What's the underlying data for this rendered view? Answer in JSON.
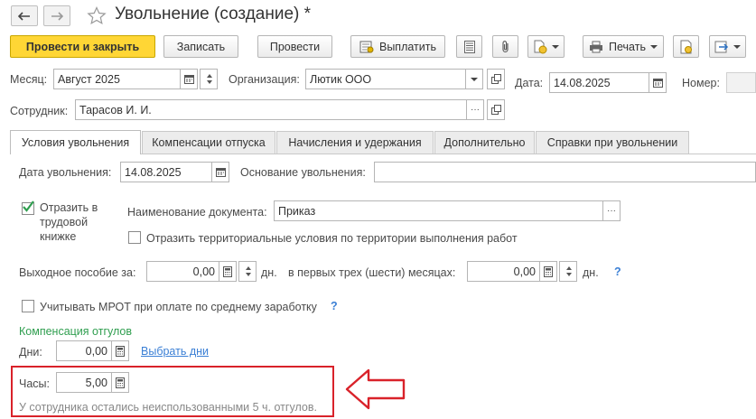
{
  "window": {
    "title": "Увольнение (создание) *"
  },
  "toolbar": {
    "post_and_close": "Провести и закрыть",
    "save": "Записать",
    "post": "Провести",
    "pay": "Выплатить",
    "print": "Печать"
  },
  "header": {
    "month_label": "Месяц:",
    "month_value": "Август 2025",
    "org_label": "Организация:",
    "org_value": "Лютик ООО",
    "date_label": "Дата:",
    "date_value": "14.08.2025",
    "number_label": "Номер:",
    "employee_label": "Сотрудник:",
    "employee_value": "Тарасов И. И."
  },
  "tabs": [
    {
      "label": "Условия увольнения"
    },
    {
      "label": "Компенсации отпуска"
    },
    {
      "label": "Начисления и удержания"
    },
    {
      "label": "Дополнительно"
    },
    {
      "label": "Справки при увольнении"
    }
  ],
  "conditions": {
    "dismissal_date_label": "Дата увольнения:",
    "dismissal_date_value": "14.08.2025",
    "dismissal_reason_label": "Основание увольнения:",
    "dismissal_reason_value": "",
    "workbook_checkbox_label_1": "Отразить в",
    "workbook_checkbox_label_2": "трудовой",
    "workbook_checkbox_label_3": "книжке",
    "doc_name_label": "Наименование документа:",
    "doc_name_value": "Приказ",
    "territorial_label": "Отразить территориальные условия по территории выполнения работ",
    "severance_label": "Выходное пособие за:",
    "severance_value": "0,00",
    "days_unit": "дн.",
    "first_months_label": "в первых трех (шести) месяцах:",
    "first_months_value": "0,00",
    "days_unit_2": "дн.",
    "help_mark": "?",
    "mrot_label": "Учитывать МРОТ при оплате по среднему заработку",
    "help_mark_2": "?",
    "comp_section_title": "Компенсация отгулов",
    "days_label": "Дни:",
    "days_value": "0,00",
    "select_days_link": "Выбрать дни",
    "hours_label": "Часы:",
    "hours_value": "5,00",
    "remaining_note": "У сотрудника остались неиспользованными 5 ч. отгулов."
  },
  "colors": {
    "primary_button": "#ffd635",
    "highlight_box": "#d9222a",
    "link": "#3a7fd5",
    "section_title": "#2f9e4f"
  }
}
